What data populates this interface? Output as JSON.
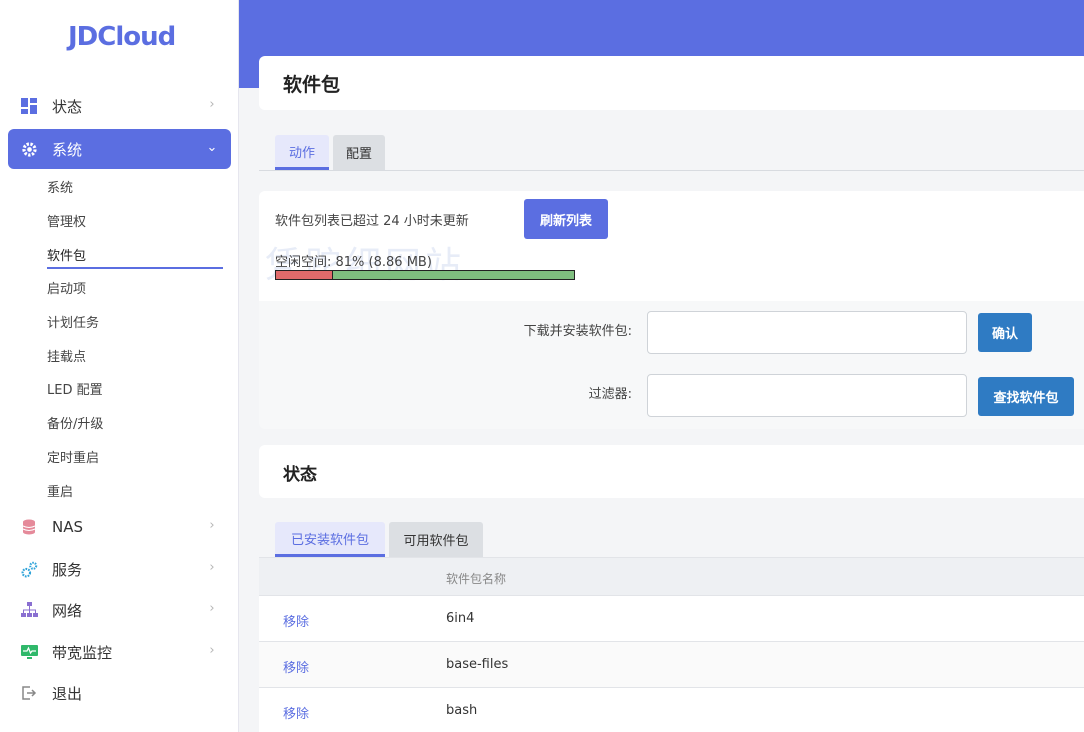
{
  "brand": "JDCloud",
  "sidebar": {
    "items": [
      {
        "label": "状态",
        "icon": "dashboard-icon"
      },
      {
        "label": "系统",
        "icon": "gear-icon"
      },
      {
        "label": "NAS",
        "icon": "database-icon"
      },
      {
        "label": "服务",
        "icon": "gears-icon"
      },
      {
        "label": "网络",
        "icon": "network-icon"
      },
      {
        "label": "带宽监控",
        "icon": "monitor-icon"
      },
      {
        "label": "退出",
        "icon": "logout-icon"
      }
    ],
    "sub_items": [
      "系统",
      "管理权",
      "软件包",
      "启动项",
      "计划任务",
      "挂载点",
      "LED 配置",
      "备份/升级",
      "定时重启",
      "重启"
    ]
  },
  "page": {
    "title": "软件包",
    "tabs": [
      "动作",
      "配置"
    ],
    "notice": "软件包列表已超过 24 小时未更新",
    "refresh_button": "刷新列表",
    "free_space": "空闲空间: 81% (8.86 MB)",
    "free_space_fraction": 0.81,
    "download_label": "下载并安装软件包:",
    "confirm_button": "确认",
    "filter_label": "过滤器:",
    "find_button": "查找软件包",
    "watermark": "凭跎细网站"
  },
  "status": {
    "title": "状态",
    "tabs": [
      "已安装软件包",
      "可用软件包"
    ],
    "column_name": "软件包名称",
    "rows": [
      {
        "action": "移除",
        "name": "6in4"
      },
      {
        "action": "移除",
        "name": "base-files"
      },
      {
        "action": "移除",
        "name": "bash"
      }
    ]
  },
  "colors": {
    "accent": "#5b6ee1",
    "blue_button": "#2f7bc3",
    "used": "#e06b6b",
    "free": "#7fbf7f"
  }
}
